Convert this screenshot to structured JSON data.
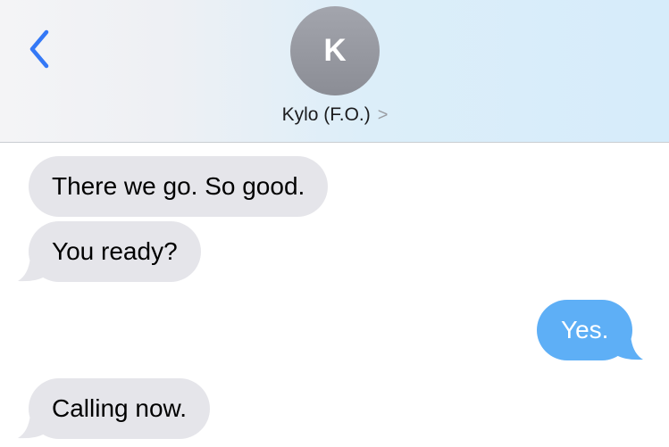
{
  "header": {
    "back_icon": "chevron-left-icon",
    "avatar_initial": "K",
    "contact_name": "Kylo (F.O.)",
    "contact_chevron": ">"
  },
  "colors": {
    "accent": "#3478f6",
    "received_bubble": "#e5e5ea",
    "sent_bubble": "#5eaff6",
    "avatar": "#979aa1"
  },
  "messages": [
    {
      "direction": "received",
      "text": "There we go. So good."
    },
    {
      "direction": "received",
      "text": "You ready?"
    },
    {
      "direction": "sent",
      "text": "Yes."
    },
    {
      "direction": "received",
      "text": "Calling now."
    }
  ]
}
